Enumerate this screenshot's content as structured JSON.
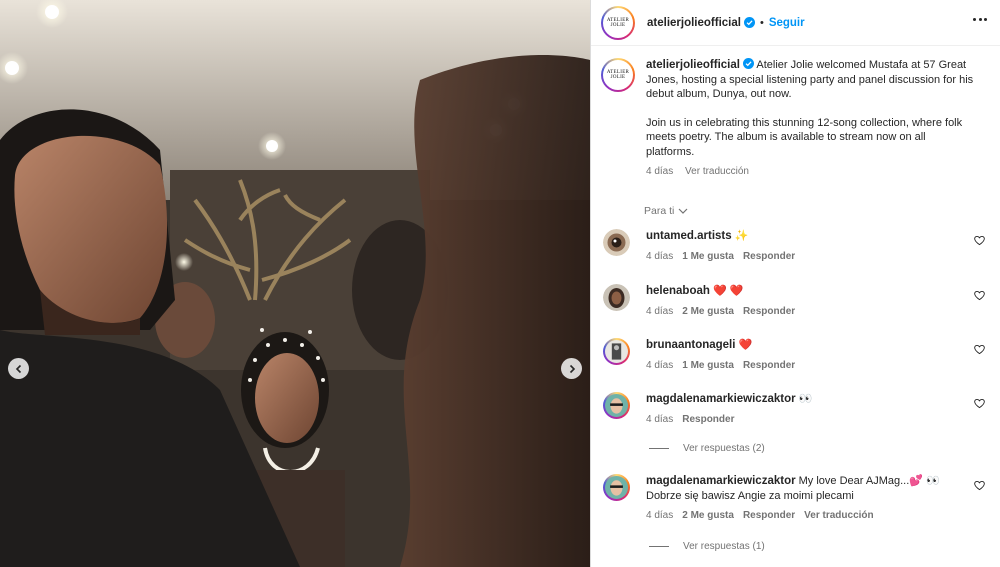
{
  "post": {
    "username": "atelierjolieofficial",
    "follow_label": "Seguir",
    "logo_line1": "ATELIER",
    "logo_line2": "JOLIE",
    "caption_p1": "Atelier Jolie welcomed Mustafa at 57 Great Jones, hosting a special listening party and panel discussion for his debut album, Dunya, out now.",
    "caption_p2": "Join us in celebrating this stunning 12-song collection, where folk meets poetry. The album is available to stream now on all platforms.",
    "time": "4 días",
    "translate": "Ver traducción",
    "sort_label": "Para ti"
  },
  "comments": [
    {
      "user": "untamed.artists",
      "text": "✨",
      "time": "4 días",
      "likes": "1 Me gusta",
      "reply": "Responder"
    },
    {
      "user": "helenaboah",
      "text": "❤️ ❤️",
      "time": "4 días",
      "likes": "2 Me gusta",
      "reply": "Responder"
    },
    {
      "user": "brunaantonageli",
      "text": "❤️",
      "time": "4 días",
      "likes": "1 Me gusta",
      "reply": "Responder"
    },
    {
      "user": "magdalenamarkiewiczaktor",
      "text": "👀",
      "time": "4 días",
      "reply": "Responder",
      "view_replies": "Ver respuestas (2)"
    },
    {
      "user": "magdalenamarkiewiczaktor",
      "text": "My love Dear AJMag...💕 👀 Dobrze się bawisz Angie za moimi plecami",
      "time": "4 días",
      "likes": "2 Me gusta",
      "reply": "Responder",
      "translate": "Ver traducción",
      "view_replies": "Ver respuestas (1)"
    }
  ],
  "colors": {
    "link_blue": "#0095f6",
    "meta_gray": "#737373",
    "heart_red": "#ff3040"
  }
}
